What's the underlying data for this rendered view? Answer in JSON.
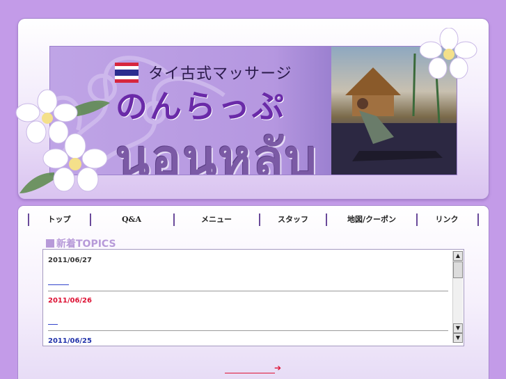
{
  "banner": {
    "subtitle": "タイ古式マッサージ",
    "title": "のんらっぷ",
    "thai_title": "นอนหลับ",
    "flag_colors": [
      "#d7263d",
      "#ffffff",
      "#2b2d8f",
      "#ffffff",
      "#d7263d"
    ]
  },
  "nav": {
    "items": [
      {
        "label": "トップ"
      },
      {
        "label": "Q&A"
      },
      {
        "label": "メニュー"
      },
      {
        "label": "スタッフ"
      },
      {
        "label": "地図/クーポン"
      },
      {
        "label": "リンク"
      }
    ]
  },
  "topics": {
    "heading": "新着TOPICS",
    "entries": [
      {
        "date": "2011/06/27",
        "date_color": "#333333",
        "link_text": ""
      },
      {
        "date": "2011/06/26",
        "date_color": "#dd1133",
        "link_text": ""
      },
      {
        "date": "2011/06/25",
        "date_color": "#2233aa",
        "link_text": ""
      }
    ],
    "scroll_up_icon": "▲",
    "scroll_down_icon": "▼"
  },
  "footer": {
    "more_arrow": "➔"
  },
  "colors": {
    "page_bg": "#c39be8",
    "accent": "#6a2aa8",
    "link": "#3344cc"
  }
}
